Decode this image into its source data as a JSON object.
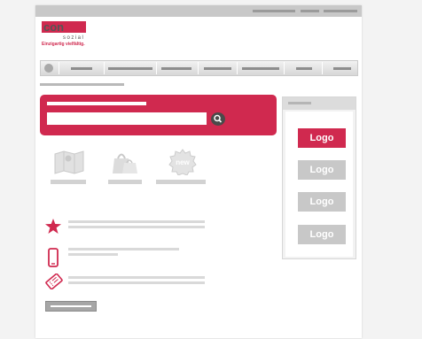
{
  "brand": {
    "name": "con",
    "subtitle": "sozial",
    "tagline": "Einzigartig vielfältig."
  },
  "sidebar": {
    "logos": [
      {
        "label": "Logo",
        "active": true
      },
      {
        "label": "Logo",
        "active": false
      },
      {
        "label": "Logo",
        "active": false
      },
      {
        "label": "Logo",
        "active": false
      }
    ]
  },
  "features": {
    "badge_new": "new"
  },
  "colors": {
    "accent": "#d0294f",
    "inactive": "#c8c8c8"
  }
}
